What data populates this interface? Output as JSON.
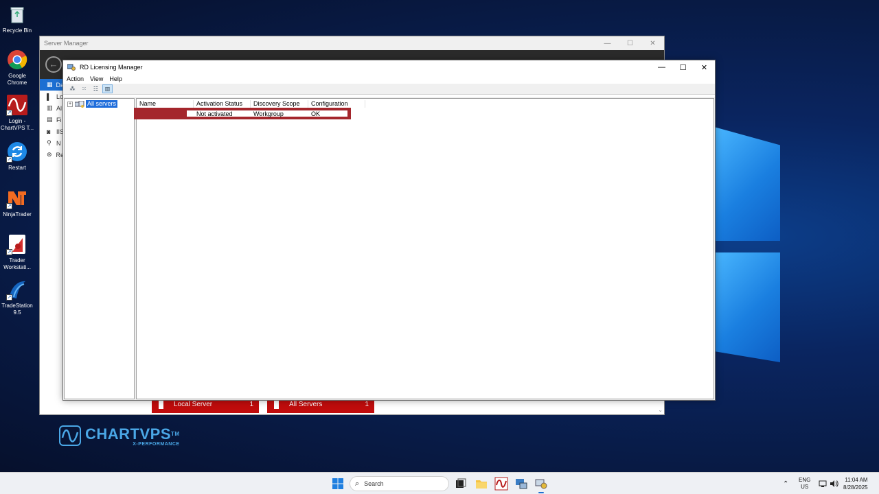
{
  "desktop": {
    "icons": [
      {
        "label": "Recycle Bin",
        "icon": "recycle-bin-icon"
      },
      {
        "label": "Google Chrome",
        "icon": "chrome-icon"
      },
      {
        "label": "Login - ChartVPS T...",
        "icon": "chartvps-login-icon"
      },
      {
        "label": "Restart",
        "icon": "restart-icon"
      },
      {
        "label": "NinjaTrader",
        "icon": "ninjatrader-icon"
      },
      {
        "label": "Trader Workstati...",
        "icon": "trader-workstation-icon"
      },
      {
        "label": "TradeStation 9.5",
        "icon": "tradestation-icon"
      }
    ]
  },
  "server_manager": {
    "title": "Server Manager",
    "nav": [
      {
        "icon": "dashboard-icon",
        "label": "Da",
        "active": true
      },
      {
        "icon": "local-server-icon",
        "label": "Lo"
      },
      {
        "icon": "all-servers-icon",
        "label": "Al"
      },
      {
        "icon": "file-storage-icon",
        "label": "Fi"
      },
      {
        "icon": "iis-icon",
        "label": "IIS"
      },
      {
        "icon": "npas-icon",
        "label": "N"
      },
      {
        "icon": "remote-desktop-icon",
        "label": "Re"
      }
    ],
    "tiles": [
      {
        "label": "Local Server",
        "count": "1"
      },
      {
        "label": "All Servers",
        "count": "1"
      }
    ]
  },
  "rd_licensing_manager": {
    "title": "RD Licensing Manager",
    "menu": [
      "Action",
      "View",
      "Help"
    ],
    "toolbar": [
      "large-icons-view-icon",
      "small-icons-view-icon",
      "list-view-icon",
      "details-view-icon"
    ],
    "tree": {
      "root_label": "All servers",
      "expander": "+"
    },
    "columns": [
      "Name",
      "Activation Status",
      "Discovery Scope",
      "Configuration"
    ],
    "rows": [
      {
        "name": "",
        "activation_status": "Not activated",
        "discovery_scope": "Workgroup",
        "configuration": "OK"
      }
    ]
  },
  "branding": {
    "title": "CHARTVPS",
    "tm": "TM",
    "subtitle": "X-PERFORMANCE"
  },
  "taskbar": {
    "search_placeholder": "Search",
    "language": "ENG",
    "region": "US",
    "time": "11:04 AM",
    "date": "8/28/2025"
  },
  "colors": {
    "accent": "#1d6fd2",
    "row_highlight": "#a4262c",
    "tile_red": "#c00c0c",
    "brand": "#4aa7e6"
  }
}
